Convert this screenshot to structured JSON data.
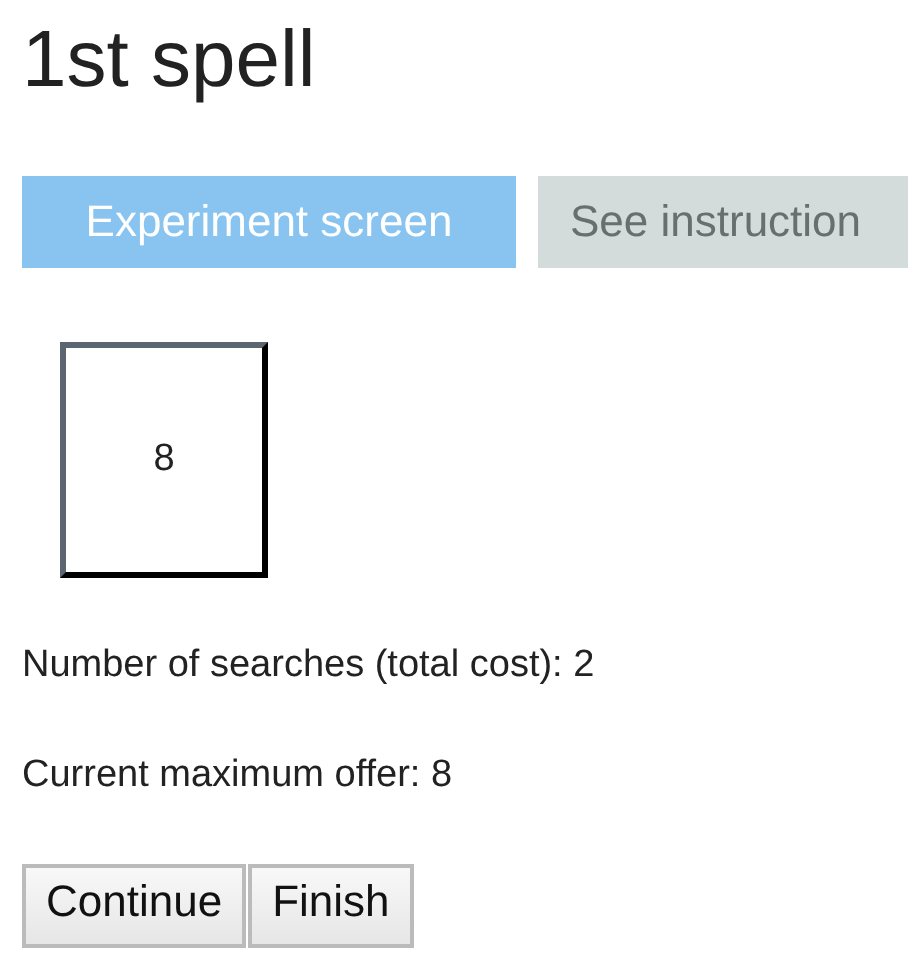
{
  "title": "1st spell",
  "tabs": [
    {
      "label": "Experiment screen",
      "selected": true
    },
    {
      "label": "See instruction",
      "selected": false
    }
  ],
  "offer_box": {
    "value": "8"
  },
  "info": [
    "Number of searches (total cost): 2",
    "Current maximum offer: 8"
  ],
  "buttons": [
    "Continue",
    "Finish"
  ]
}
